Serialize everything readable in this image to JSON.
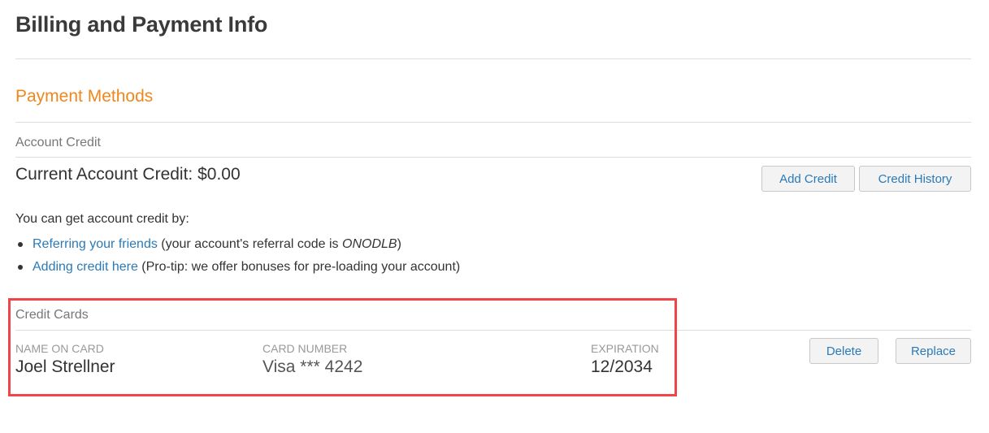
{
  "header": {
    "title": "Billing and Payment Info"
  },
  "payment_methods": {
    "title": "Payment Methods",
    "account_credit": {
      "subtitle": "Account Credit",
      "current_credit_label": "Current Account Credit: $0.00",
      "buttons": {
        "add_credit": "Add Credit",
        "credit_history": "Credit History"
      },
      "info_intro": "You can get account credit by:",
      "options": [
        {
          "link": "Referring your friends",
          "text_before_code": " (your account's referral code is ",
          "code": "ONODLB",
          "text_after_code": ")"
        },
        {
          "link": "Adding credit here",
          "text": " (Pro-tip: we offer bonuses for pre-loading your account)"
        }
      ]
    },
    "credit_cards": {
      "subtitle": "Credit Cards",
      "columns": {
        "name": "NAME ON CARD",
        "number": "CARD NUMBER",
        "expiration": "EXPIRATION"
      },
      "cards": [
        {
          "name": "Joel Strellner",
          "number": "Visa *** 4242",
          "expiration": "12/2034"
        }
      ],
      "buttons": {
        "delete": "Delete",
        "replace": "Replace"
      }
    }
  },
  "colors": {
    "accent": "#f0871c",
    "link": "#2a7ab8",
    "highlight": "#f0434a"
  }
}
